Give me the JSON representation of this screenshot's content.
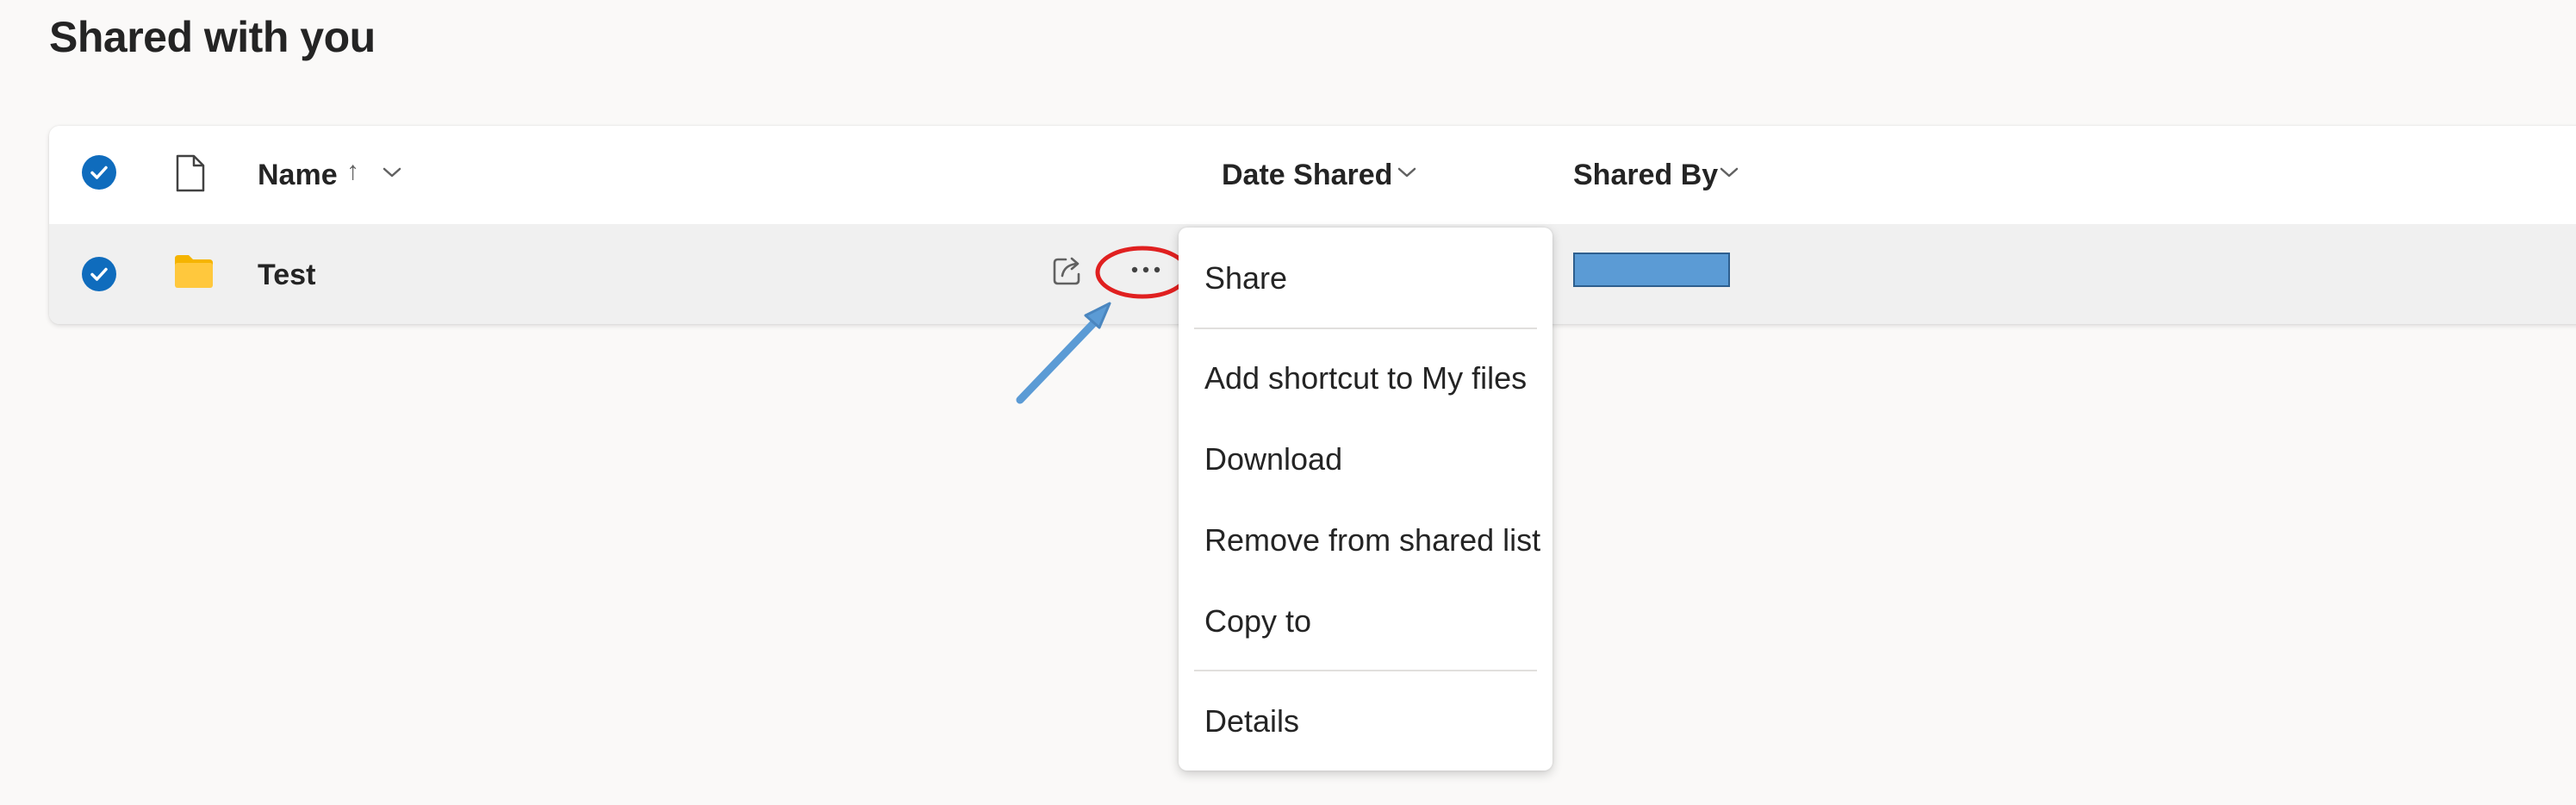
{
  "page": {
    "title": "Shared with you"
  },
  "table": {
    "columns": {
      "name": "Name",
      "name_sort_glyph": "↑",
      "date_shared": "Date Shared",
      "shared_by": "Shared By"
    },
    "rows": [
      {
        "name": "Test",
        "type": "folder",
        "selected": true
      }
    ]
  },
  "context_menu": {
    "items": [
      "Share",
      "Add shortcut to My files",
      "Download",
      "Remove from shared list",
      "Copy to",
      "Details"
    ]
  },
  "colors": {
    "accent": "#0f6cbd",
    "folder": "#ffc83d",
    "annotation_circle": "#e02020",
    "annotation_arrow": "#5b9bd5"
  }
}
